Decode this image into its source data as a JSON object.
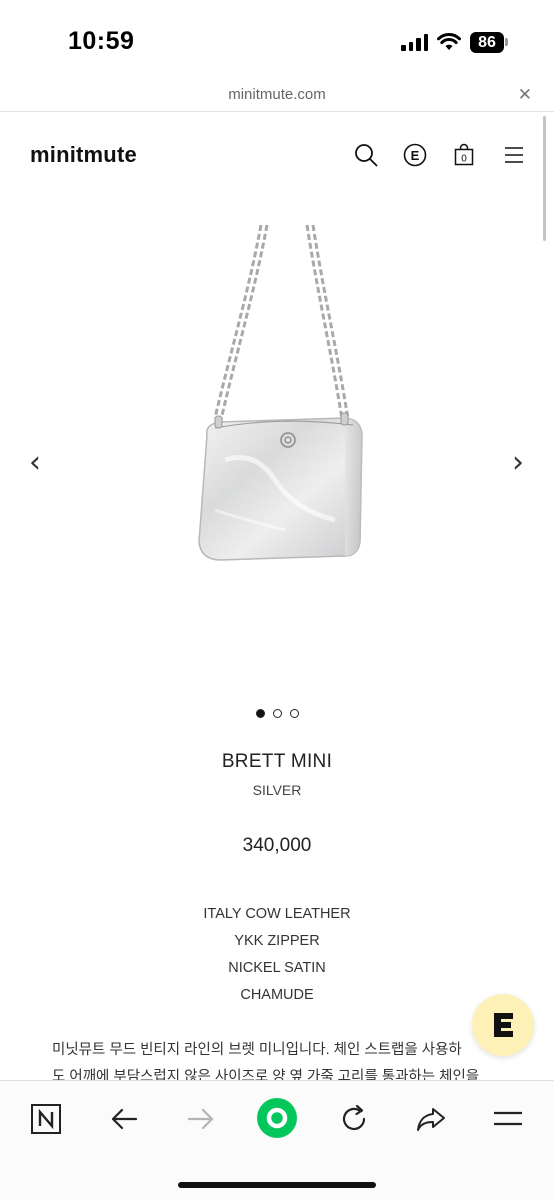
{
  "status_bar": {
    "time": "10:59",
    "battery": "86"
  },
  "browser": {
    "url": "minitmute.com",
    "close_label": "✕"
  },
  "site": {
    "logo": "minitmute",
    "header_icons": [
      "search-icon",
      "brand-e-icon",
      "shopping-bag-icon",
      "menu-icon"
    ],
    "cart_count": "0"
  },
  "gallery": {
    "prev_label": "‹",
    "next_label": "›",
    "slide_count": 3,
    "active_slide": 1
  },
  "product": {
    "name": "BRETT MINI",
    "color": "SILVER",
    "price": "340,000",
    "specs": [
      "ITALY COW LEATHER",
      "YKK ZIPPER",
      "NICKEL SATIN",
      "CHAMUDE"
    ],
    "description_lines": [
      "미닛뮤트 무드 빈티지 라인의 브렛 미니입니다. 체인 스트랩을 사용하",
      "도 어깨에 부담스럽지 않은 사이즈로 양 옆 가죽 고리를 통과하는 체인을"
    ]
  },
  "chat_button": {
    "label": "E",
    "bg_color": "#fdf1b8"
  },
  "toolbar": {
    "items": [
      "naver-home-icon",
      "back-arrow-icon",
      "forward-arrow-icon",
      "green-circle-icon",
      "reload-icon",
      "share-icon",
      "menu-icon"
    ],
    "accent_color": "#03c75a"
  }
}
